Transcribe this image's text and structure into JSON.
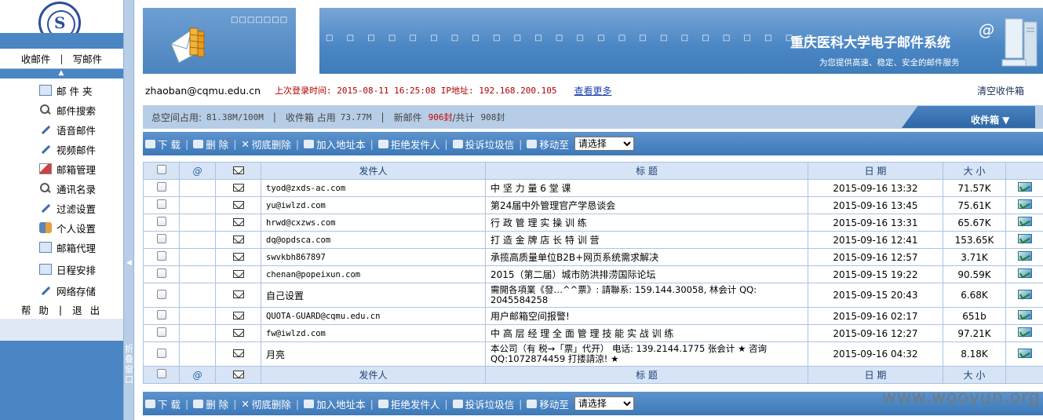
{
  "app_title": "重庆医科大学电子邮件系统",
  "slogan": "为您提供高速、稳定、安全的邮件服务",
  "banner_dots": "□□□□□□□",
  "banner_dotrow": "□ □ □ □ □ □ □ □ □ □ □ □ □ □ □ □ □ □ □ □ □ □ □ □ □ □ □ □ □ □",
  "left": {
    "quick": {
      "inbox": "收邮件",
      "sep": "|",
      "compose": "写邮件"
    },
    "menu": [
      {
        "label": "邮 件 夹",
        "icon": "mailbox-icon"
      },
      {
        "label": "邮件搜索",
        "icon": "search-icon"
      },
      {
        "label": "语音邮件",
        "icon": "voice-mail-icon"
      },
      {
        "label": "视频邮件",
        "icon": "video-mail-icon"
      },
      {
        "label": "邮箱管理",
        "icon": "mailbox-manage-icon"
      },
      {
        "label": "通讯名录",
        "icon": "address-book-icon"
      },
      {
        "label": "过滤设置",
        "icon": "filter-icon"
      },
      {
        "label": "个人设置",
        "icon": "personal-settings-icon"
      },
      {
        "label": "邮箱代理",
        "icon": "proxy-icon"
      },
      {
        "label": "日程安排",
        "icon": "calendar-icon"
      },
      {
        "label": "网络存储",
        "icon": "storage-icon"
      }
    ],
    "help": "帮 助",
    "help_sep": "|",
    "logout": "退 出",
    "splitter_text": "折叠窗口"
  },
  "info": {
    "user": "zhaoban@cqmu.edu.cn",
    "last_login": "上次登录时间: 2015-08-11 16:25:08 IP地址: 192.168.200.105",
    "more": "查看更多",
    "clear_inbox": "清空收件箱"
  },
  "quota": {
    "space_label": "总空间占用:",
    "space_value": "81.38M/100M",
    "sep": "|",
    "inbox_label": "收件箱 占用",
    "inbox_value": "73.77M",
    "new_label": "新邮件",
    "new_value": "906封",
    "total_label": "/共计",
    "total_value": "908封",
    "folder_button": "收件箱 ▼"
  },
  "toolbar": {
    "download": "下 载",
    "delete": "删 除",
    "purge": "彻底删除",
    "add_address": "加入地址本",
    "reject_sender": "拒绝发件人",
    "report_spam": "投诉垃圾信",
    "move_to": "移动至",
    "select_value": "请选择"
  },
  "table": {
    "headers": {
      "attachment": "@",
      "sender": "发件人",
      "subject": "标 题",
      "date": "日 期",
      "size": "大 小"
    },
    "rows": [
      {
        "sender": "tyod@zxds-ac.com",
        "subject": "中 坚 力 量 6 堂 课",
        "date": "2015-09-16 13:32",
        "size": "71.57K"
      },
      {
        "sender": "yu@iwlzd.com",
        "subject": "第24届中外管理官产学恳谈会",
        "date": "2015-09-16 13:45",
        "size": "75.61K"
      },
      {
        "sender": "hrwd@cxzws.com",
        "subject": "行 政 管 理 实 操 训 练",
        "date": "2015-09-16 13:31",
        "size": "65.67K"
      },
      {
        "sender": "dq@opdsca.com",
        "subject": "打 造 金 牌 店 长 特 训 营",
        "date": "2015-09-16 12:41",
        "size": "153.65K"
      },
      {
        "sender": "swvkbh867897",
        "subject": "承揽高质量单位B2B+网页系统需求解决",
        "date": "2015-09-16 12:57",
        "size": "3.71K"
      },
      {
        "sender": "chenan@popeixun.com",
        "subject": "2015（第二届）城市防洪排涝国际论坛",
        "date": "2015-09-15 19:22",
        "size": "90.59K"
      },
      {
        "sender": "自己设置",
        "subject": "需開各項業《發…^^票》: 請聯系: 159.144.30058, 林会计 QQ: 2045584258",
        "date": "2015-09-15 20:43",
        "size": "6.68K"
      },
      {
        "sender": "QUOTA-GUARD@cqmu.edu.cn",
        "subject": "用户邮箱空间报警!",
        "date": "2015-09-16 02:17",
        "size": "651b"
      },
      {
        "sender": "fw@iwlzd.com",
        "subject": "中 高 层 经 理 全 面 管 理 技 能 实 战 训 练",
        "date": "2015-09-16 12:27",
        "size": "97.21K"
      },
      {
        "sender": "月亮",
        "subject": "本公司（有 税→「票」代开） 电话: 139.2144.1775 张会计 ★ 咨询QQ:1072874459 打搂請涼! ★",
        "date": "2015-09-16 04:32",
        "size": "8.18K"
      }
    ]
  },
  "watermark": "www.wooyun.org",
  "colors": {
    "accent": "#4a86c3",
    "banner": "#4a86c4",
    "alert_red": "#b10000"
  }
}
